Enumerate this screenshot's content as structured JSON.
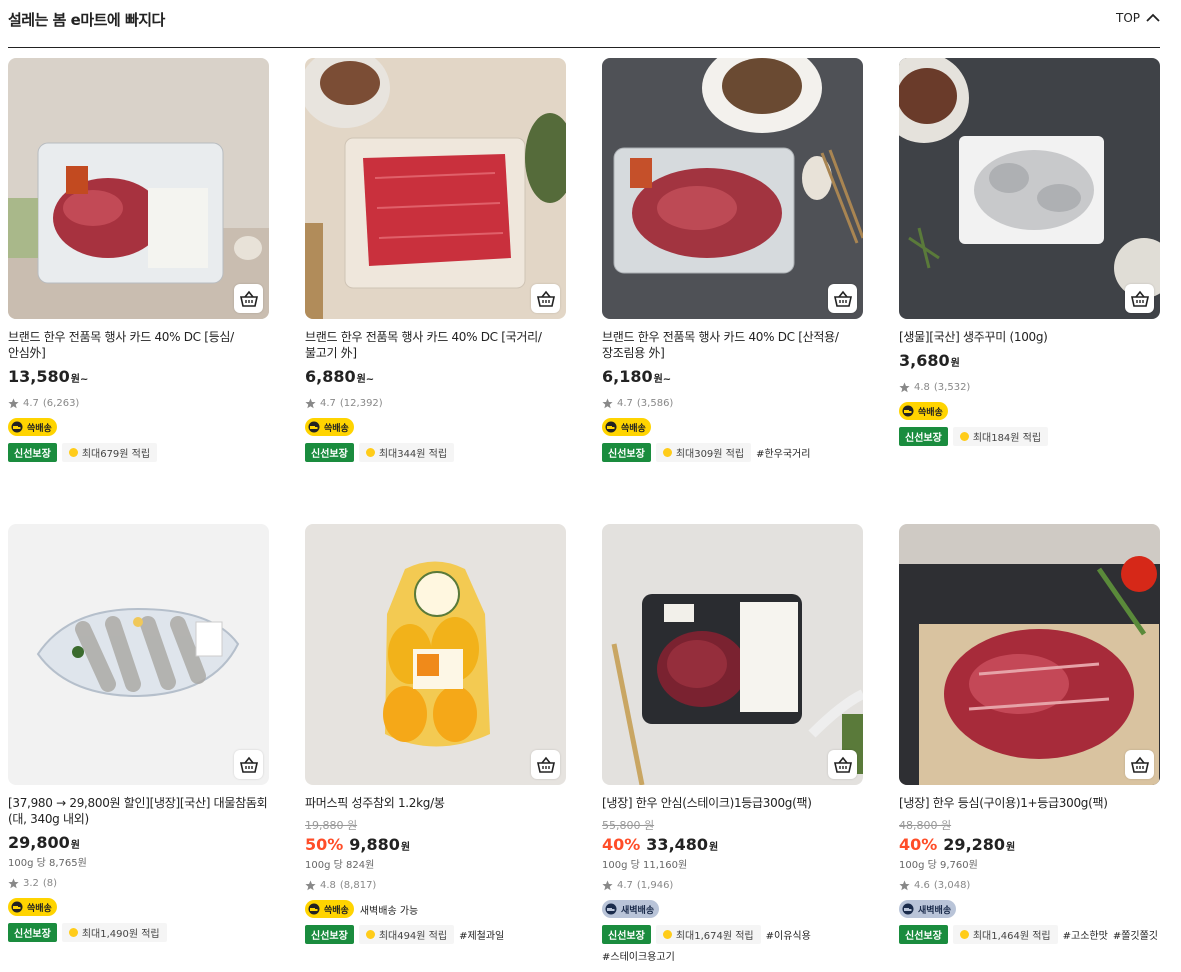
{
  "section": {
    "title": "설레는 봄 e마트에 빠지다",
    "top_label": "TOP"
  },
  "products": [
    {
      "name": "브랜드 한우 전품목 행사 카드 40% DC [등심/안심外]",
      "orig": "",
      "discount": "",
      "price": "13,580",
      "won": "원~",
      "unit": "",
      "rating": "4.7",
      "reviews": "(6,263)",
      "delivery": "쓱배송",
      "delivery_type": "ssg",
      "delivery_extra": "",
      "fresh": "신선보장",
      "point": "최대679원 적립",
      "tags": []
    },
    {
      "name": "브랜드 한우 전품목 행사 카드 40% DC [국거리/불고기 外]",
      "orig": "",
      "discount": "",
      "price": "6,880",
      "won": "원~",
      "unit": "",
      "rating": "4.7",
      "reviews": "(12,392)",
      "delivery": "쓱배송",
      "delivery_type": "ssg",
      "delivery_extra": "",
      "fresh": "신선보장",
      "point": "최대344원 적립",
      "tags": []
    },
    {
      "name": "브랜드 한우 전품목 행사 카드 40% DC [산적용/장조림용 外]",
      "orig": "",
      "discount": "",
      "price": "6,180",
      "won": "원~",
      "unit": "",
      "rating": "4.7",
      "reviews": "(3,586)",
      "delivery": "쓱배송",
      "delivery_type": "ssg",
      "delivery_extra": "",
      "fresh": "신선보장",
      "point": "최대309원 적립",
      "tags": [
        "#한우국거리"
      ]
    },
    {
      "name": "[생물][국산] 생주꾸미 (100g)",
      "orig": "",
      "discount": "",
      "price": "3,680",
      "won": "원",
      "unit": "",
      "rating": "4.8",
      "reviews": "(3,532)",
      "delivery": "쓱배송",
      "delivery_type": "ssg",
      "delivery_extra": "",
      "fresh": "신선보장",
      "point": "최대184원 적립",
      "tags": []
    },
    {
      "name": "[37,980 → 29,800원 할인][냉장][국산] 대물참돔회 (대, 340g 내외)",
      "orig": "",
      "discount": "",
      "price": "29,800",
      "won": "원",
      "unit": "100g 당 8,765원",
      "rating": "3.2",
      "reviews": "(8)",
      "delivery": "쓱배송",
      "delivery_type": "ssg",
      "delivery_extra": "",
      "fresh": "신선보장",
      "point": "최대1,490원 적립",
      "tags": []
    },
    {
      "name": "파머스픽 성주참외 1.2kg/봉",
      "orig": "19,880 원",
      "discount": "50%",
      "price": "9,880",
      "won": "원",
      "unit": "100g 당 824원",
      "rating": "4.8",
      "reviews": "(8,817)",
      "delivery": "쓱배송",
      "delivery_type": "ssg",
      "delivery_extra": "새벽배송 가능",
      "fresh": "신선보장",
      "point": "최대494원 적립",
      "tags": [
        "#제철과일"
      ]
    },
    {
      "name": "[냉장] 한우 안심(스테이크)1등급300g(팩)",
      "orig": "55,800 원",
      "discount": "40%",
      "price": "33,480",
      "won": "원",
      "unit": "100g 당 11,160원",
      "rating": "4.7",
      "reviews": "(1,946)",
      "delivery": "새벽배송",
      "delivery_type": "dawn",
      "delivery_extra": "",
      "fresh": "신선보장",
      "point": "최대1,674원 적립",
      "tags": [
        "#이유식용",
        "#스테이크용고기"
      ]
    },
    {
      "name": "[냉장] 한우 등심(구이용)1+등급300g(팩)",
      "orig": "48,800 원",
      "discount": "40%",
      "price": "29,280",
      "won": "원",
      "unit": "100g 당 9,760원",
      "rating": "4.6",
      "reviews": "(3,048)",
      "delivery": "새벽배송",
      "delivery_type": "dawn",
      "delivery_extra": "",
      "fresh": "신선보장",
      "point": "최대1,464원 적립",
      "tags": [
        "#고소한맛",
        "#쫄깃쫄깃"
      ]
    }
  ],
  "colors": {
    "discount": "#ff4d28",
    "fresh": "#1a8c3e",
    "ssg": "#ffd400",
    "dawn": "#b9c4d8"
  }
}
